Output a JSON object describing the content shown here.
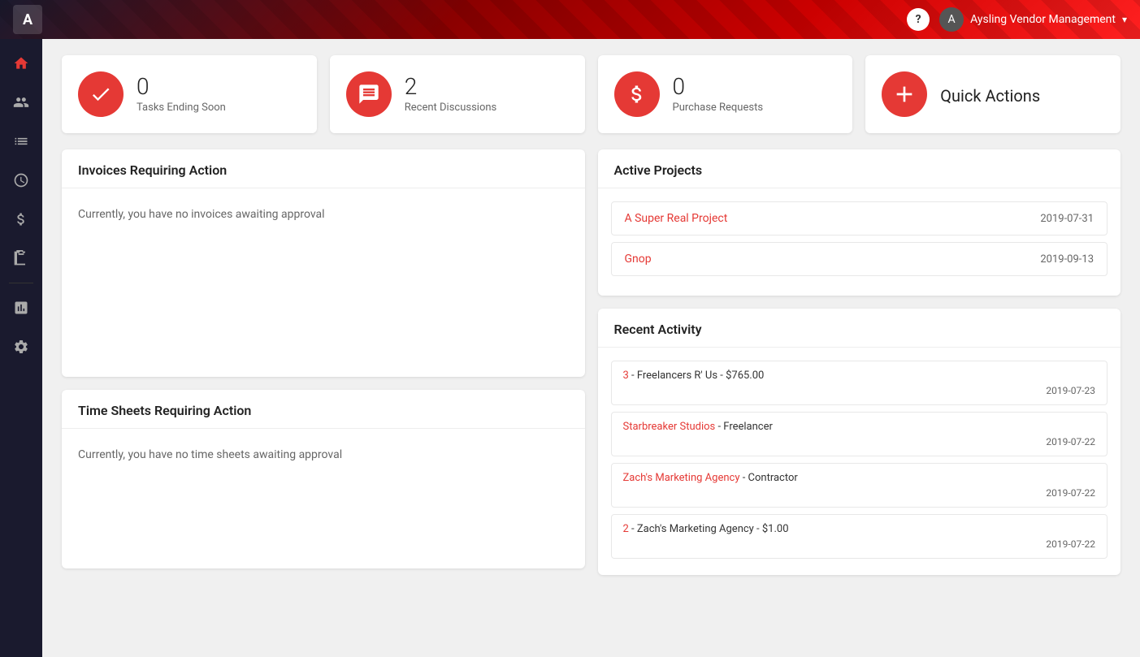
{
  "topNav": {
    "logoText": "A",
    "helpLabel": "?",
    "userName": "Aysling Vendor Management",
    "userInitial": "A",
    "dropdownArrow": "▾"
  },
  "sidebar": {
    "items": [
      {
        "id": "home",
        "icon": "⌂",
        "label": "Home",
        "active": true
      },
      {
        "id": "users",
        "icon": "👥",
        "label": "Users",
        "active": false
      },
      {
        "id": "list",
        "icon": "☰",
        "label": "List",
        "active": false
      },
      {
        "id": "clock",
        "icon": "🕐",
        "label": "Time",
        "active": false
      },
      {
        "id": "dollar",
        "icon": "$",
        "label": "Finance",
        "active": false
      },
      {
        "id": "book",
        "icon": "📋",
        "label": "Reports",
        "active": false
      },
      {
        "id": "chart",
        "icon": "📊",
        "label": "Analytics",
        "active": false
      },
      {
        "id": "gear",
        "icon": "⚙",
        "label": "Settings",
        "active": false
      }
    ]
  },
  "statCards": [
    {
      "id": "tasks",
      "iconType": "checkmark",
      "number": "0",
      "label": "Tasks Ending Soon"
    },
    {
      "id": "discussions",
      "iconType": "discussions",
      "number": "2",
      "label": "Recent Discussions"
    },
    {
      "id": "purchase",
      "iconType": "dollar",
      "number": "0",
      "label": "Purchase Requests"
    },
    {
      "id": "quickactions",
      "iconType": "plus",
      "number": "",
      "label": "Quick Actions"
    }
  ],
  "invoicesPanel": {
    "title": "Invoices Requiring Action",
    "emptyText": "Currently, you have no invoices awaiting approval"
  },
  "activeProjects": {
    "title": "Active Projects",
    "projects": [
      {
        "name": "A Super Real Project",
        "date": "2019-07-31"
      },
      {
        "name": "Gnop",
        "date": "2019-09-13"
      }
    ]
  },
  "timeSheetsPanel": {
    "title": "Time Sheets Requiring Action",
    "emptyText": "Currently, you have no time sheets awaiting approval"
  },
  "recentActivity": {
    "title": "Recent Activity",
    "items": [
      {
        "id": "act1",
        "linkText": "3",
        "linkHref": "#",
        "restText": " - Freelancers R' Us - $765.00",
        "date": "2019-07-23",
        "hasLink": true
      },
      {
        "id": "act2",
        "linkText": "Starbreaker Studios",
        "linkHref": "#",
        "restText": " - Freelancer",
        "date": "2019-07-22",
        "hasLink": true
      },
      {
        "id": "act3",
        "linkText": "Zach's Marketing Agency",
        "linkHref": "#",
        "restText": " - Contractor",
        "date": "2019-07-22",
        "hasLink": true
      },
      {
        "id": "act4",
        "linkText": "2",
        "linkHref": "#",
        "restText": " - Zach's Marketing Agency - $1.00",
        "date": "2019-07-22",
        "hasLink": true
      }
    ]
  }
}
